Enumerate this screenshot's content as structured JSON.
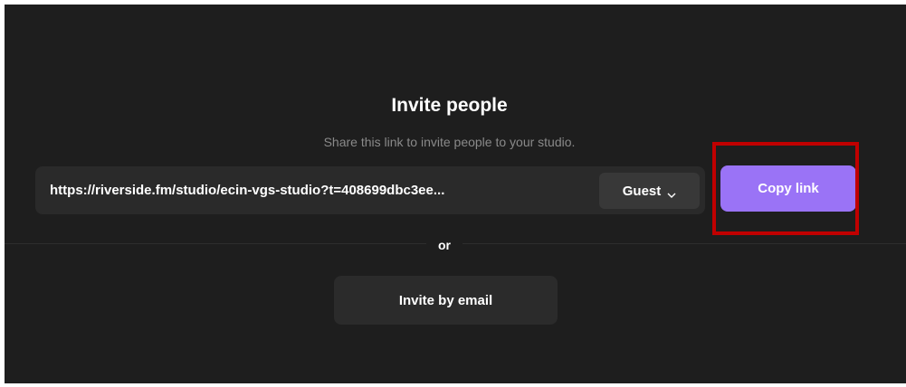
{
  "dialog": {
    "title": "Invite people",
    "subtitle": "Share this link to invite people to your studio."
  },
  "invite_link": {
    "url": "https://riverside.fm/studio/ecin-vgs-studio?t=408699dbc3ee...",
    "role": "Guest",
    "role_icon": "chevron-down-icon",
    "copy_label": "Copy link"
  },
  "separator": {
    "label": "or"
  },
  "email_invite": {
    "label": "Invite by email"
  },
  "colors": {
    "background": "#1e1e1e",
    "accent": "#9a73f6",
    "highlight": "#c00000"
  }
}
